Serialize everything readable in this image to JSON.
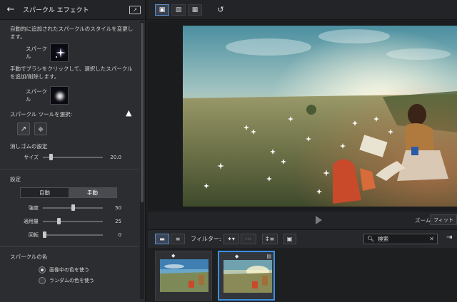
{
  "panel": {
    "title": "スパークル エフェクト",
    "auto_desc": "自動的に追加されたスパークルのスタイルを変更します。",
    "sparkle_label_1": "スパークル",
    "manual_desc": "手動でブラシをクリックして、選択したスパークルを追加/削除します。",
    "sparkle_label_2": "スパークル",
    "tool_select_label": "スパークル ツールを選択:",
    "eraser_settings_label": "消しゴムの設定",
    "size_label": "サイズ",
    "size_value": "20.0",
    "size_level": 0.12,
    "settings_label": "設定",
    "mode_auto": "自動",
    "mode_manual": "手動",
    "mode_selected": "manual",
    "intensity_label": "強度",
    "intensity_value": "50",
    "intensity_level": 0.5,
    "amount_label": "適用量",
    "amount_value": "25",
    "amount_level": 0.25,
    "rotation_label": "回転",
    "rotation_value": "0",
    "rotation_level": 0.0,
    "color_label": "スパークルの色",
    "color_option_1": "画像中の色を使う",
    "color_option_2": "ランダムの色を使う",
    "color_selected": "image"
  },
  "toolbar": {
    "icons": [
      "single-view-icon",
      "compare-view-icon",
      "grid-view-icon",
      "rotate-icon"
    ]
  },
  "playback": {
    "zoom_label": "ズーム:",
    "zoom_value": "フィット"
  },
  "filterbar": {
    "filter_label": "フィルター:",
    "search_placeholder": "検索"
  },
  "library": {
    "thumbnails": [
      {
        "selected": false
      },
      {
        "selected": true
      }
    ]
  },
  "colors": {
    "accent": "#3a8fe0",
    "panel_bg": "#2c2d30",
    "app_bg": "#1f2022"
  }
}
